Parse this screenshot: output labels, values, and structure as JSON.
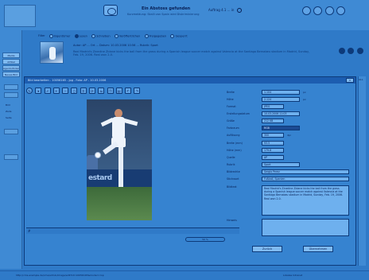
{
  "header": {
    "title": "Ein Abstoss gefunden",
    "subtitle": "Kurzmeldung: Skalli von Spain wird Diskriminierung",
    "status_text": "Auftrag 4.1 ... in",
    "icons": [
      "refresh-icon",
      "home-icon",
      "print-icon",
      "help-icon"
    ]
  },
  "leftrail": {
    "items": [
      "Media",
      "Artikel",
      "Agenturticker",
      "Neues Bild",
      "Bild",
      "Text",
      "Audio"
    ],
    "sections": [
      "Bild",
      "Zeile",
      "Seite"
    ]
  },
  "filters": {
    "label": "Filter",
    "options": [
      "Eigentümer",
      "Lesen",
      "Schreiben",
      "Veröffentlichen",
      "Freigegeben",
      "Gesperrt"
    ],
    "selected_index": 1
  },
  "summary": {
    "meta": "Autor: AP ... Ort ... Datum: 10.03.2006 10:56 ... Rubrik: Sport",
    "text": "Real Madrid's Zinedine Zidane kicks the ball from the grass during a Spanish league soccer match against Valencia at the Santiago Bernabeu stadium in Madrid, Sunday, Feb. 19, 2006. Real won 2-0."
  },
  "dialog": {
    "title": "Bild bearbeiten - 10056165 - jpg - Foto: AP - 10.03.2006",
    "close_label": "x",
    "tools": [
      "refresh-icon",
      "chevron-down-icon",
      "arrow-icon",
      "zoom-in-icon",
      "zoom-out-icon",
      "fit-icon",
      "crop-icon",
      "rotate-icon",
      "flip-icon",
      "copy-icon",
      "paste-icon",
      "undo-icon",
      "redo-icon"
    ],
    "photo_caption": "estard",
    "bottom_label": "#",
    "slider_label": "50 %",
    "ok_label": "Zurück",
    "cancel_label": "Übernehmen"
  },
  "properties": {
    "rows": [
      {
        "label": "Breite",
        "value": "1.104",
        "unit": "px"
      },
      {
        "label": "Höhe",
        "value": "2.124",
        "unit": "px"
      },
      {
        "label": "Format",
        "value": "JPEG",
        "unit": ""
      },
      {
        "label": "Erstellungsdatum",
        "value": "10.03.2006 11:03",
        "unit": ""
      },
      {
        "label": "Größe",
        "value": "212 KB",
        "unit": ""
      },
      {
        "label": "Farbraum",
        "value": "RGB",
        "unit": ""
      },
      {
        "label": "Auflösung",
        "value": "300",
        "unit": "dpi"
      },
      {
        "label": "Breite (mm)",
        "value": "93.5",
        "unit": ""
      },
      {
        "label": "Höhe (mm)",
        "value": "179.8",
        "unit": ""
      },
      {
        "label": "Quelle",
        "value": "AP",
        "unit": ""
      },
      {
        "label": "Rubrik",
        "value": "Sport",
        "unit": ""
      },
      {
        "label": "Bildrechte",
        "value": "Sergio Perez",
        "unit": ""
      },
      {
        "label": "Stichwort",
        "value": "Fußball, Spanien",
        "unit": ""
      }
    ],
    "caption_label": "Bildtext",
    "caption": "Real Madrid's Zinedine Zidane kicks the ball from the grass during a Spanish league soccer match against Valencia at the Santiago Bernabeu stadium in Madrid, Sunday, Feb. 19, 2006. Real won 2-0.",
    "note_label": "Hinweis"
  },
  "statusbar": {
    "url": "http://cms.example.de/cms/admin/image/edit?id=10056165&mode=crop",
    "zone": "Lokales Intranet"
  },
  "right_scroll_label": "ALL"
}
